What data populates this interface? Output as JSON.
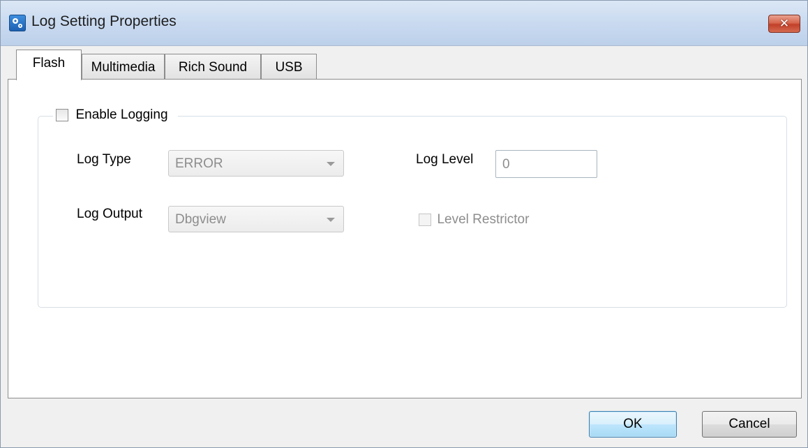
{
  "window": {
    "title": "Log Setting Properties",
    "close_label": "✕"
  },
  "tabs": [
    {
      "label": "Flash",
      "active": true
    },
    {
      "label": "Multimedia",
      "active": false
    },
    {
      "label": "Rich Sound",
      "active": false
    },
    {
      "label": "USB",
      "active": false
    }
  ],
  "group": {
    "enable_label": "Enable Logging",
    "enable_checked": false
  },
  "fields": {
    "log_type_label": "Log Type",
    "log_type_value": "ERROR",
    "log_output_label": "Log Output",
    "log_output_value": "Dbgview",
    "log_level_label": "Log Level",
    "log_level_value": "0",
    "level_restrictor_label": "Level Restrictor",
    "level_restrictor_checked": false
  },
  "buttons": {
    "ok": "OK",
    "cancel": "Cancel"
  },
  "icons": {
    "app": "settings-app-icon",
    "close": "close-icon"
  },
  "colors": {
    "close_button": "#c2402a",
    "title_bar": "#c9daf0",
    "disabled_text": "#8d8d8d"
  }
}
